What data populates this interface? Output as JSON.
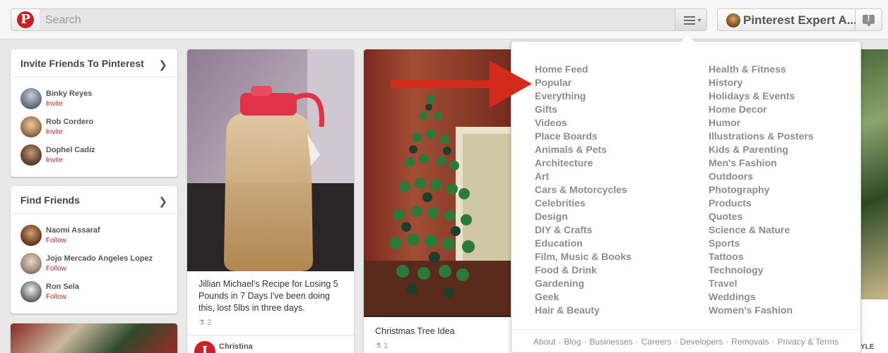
{
  "header": {
    "search_placeholder": "Search",
    "user_name": "Pinterest Expert A..."
  },
  "sidebar": {
    "invite_card": {
      "title": "Invite Friends To Pinterest",
      "friends": [
        {
          "name": "Binky Reyes",
          "action": "Invite"
        },
        {
          "name": "Rob Cordero",
          "action": "Invite"
        },
        {
          "name": "Dophel Cadiz",
          "action": "Invite"
        }
      ]
    },
    "find_card": {
      "title": "Find Friends",
      "friends": [
        {
          "name": "Naomi Assaraf",
          "action": "Follow"
        },
        {
          "name": "Jojo Mercado Angeles Lopez",
          "action": "Follow"
        },
        {
          "name": "Ron Sela",
          "action": "Follow"
        }
      ]
    }
  },
  "pins": [
    {
      "description": "Jillian Michael's Recipe for Losing 5 Pounds in 7 Days I've been doing this, lost 5lbs in three days.",
      "repins": "2",
      "pinner": "Christina"
    },
    {
      "description": "Christmas Tree Idea",
      "repins": "1"
    }
  ],
  "categories": {
    "left": [
      "Home Feed",
      "Popular",
      "Everything",
      "Gifts",
      "Videos",
      "Place Boards",
      "Animals & Pets",
      "Architecture",
      "Art",
      "Cars & Motorcycles",
      "Celebrities",
      "Design",
      "DIY & Crafts",
      "Education",
      "Film, Music & Books",
      "Food & Drink",
      "Gardening",
      "Geek",
      "Hair & Beauty"
    ],
    "right": [
      "Health & Fitness",
      "History",
      "Holidays & Events",
      "Home Decor",
      "Humor",
      "Illustrations & Posters",
      "Kids & Parenting",
      "Men's Fashion",
      "Outdoors",
      "Photography",
      "Products",
      "Quotes",
      "Science & Nature",
      "Sports",
      "Tattoos",
      "Technology",
      "Travel",
      "Weddings",
      "Women's Fashion"
    ]
  },
  "footer_links": [
    "About",
    "Blog",
    "Businesses",
    "Careers",
    "Developers",
    "Removals",
    "Privacy & Terms"
  ],
  "edge_text": "YLE",
  "colors": {
    "brand_red": "#cb2027",
    "arrow_red": "#d42a1c"
  }
}
